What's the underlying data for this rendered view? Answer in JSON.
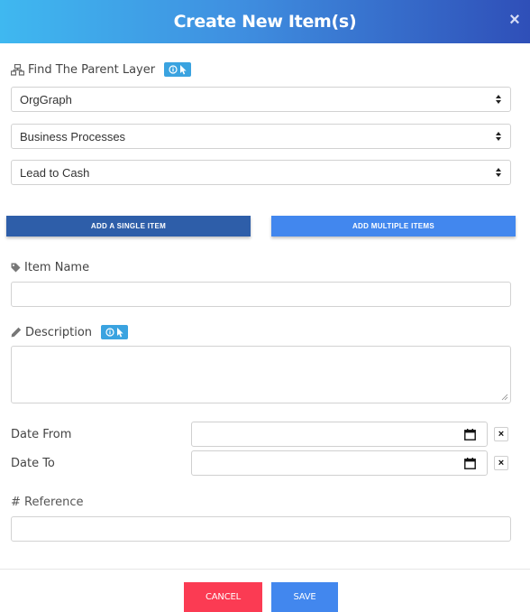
{
  "header": {
    "title": "Create New Item(s)",
    "close_label": "×"
  },
  "parent_layer": {
    "label": "Find The Parent Layer",
    "selects": [
      {
        "value": "OrgGraph"
      },
      {
        "value": "Business Processes"
      },
      {
        "value": "Lead to Cash"
      }
    ]
  },
  "tabs": [
    {
      "label": "ADD A SINGLE ITEM",
      "active": true
    },
    {
      "label": "ADD MULTIPLE ITEMS",
      "active": false
    }
  ],
  "form": {
    "item_name_label": "Item Name",
    "item_name_value": "",
    "description_label": "Description",
    "description_value": "",
    "date_from_label": "Date From",
    "date_to_label": "Date To",
    "clear_label": "×",
    "reference_label": "# Reference",
    "reference_value": ""
  },
  "footer": {
    "cancel_label": "CANCEL",
    "save_label": "SAVE"
  },
  "colors": {
    "header_gradient_start": "#3fb8f0",
    "header_gradient_end": "#2f4fb8",
    "active_tab": "#2e5ea9",
    "inactive_tab": "#4287ee",
    "cancel": "#fb3b53",
    "save": "#4287ee",
    "help_badge": "#3aa3e0"
  },
  "icons": {
    "parent_layer": "sitemap-icon",
    "help": "info-pointer-icon",
    "item_name": "tag-icon",
    "description": "pencil-icon",
    "date": "calendar-icon"
  }
}
